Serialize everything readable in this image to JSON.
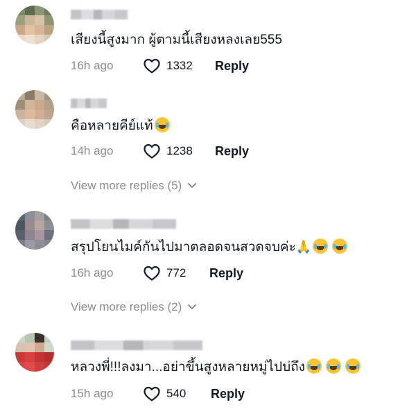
{
  "comments": [
    {
      "text": "เสียงนี้สูงมาก ผู้ตามนี้เสียงหลงเลย555",
      "emojis": [],
      "time": "16h ago",
      "likes": "1332",
      "reply_label": "Reply"
    },
    {
      "text": "คือหลายคีย์แท้",
      "emojis": [
        "😂"
      ],
      "time": "14h ago",
      "likes": "1238",
      "reply_label": "Reply",
      "view_more": "View more replies (5)"
    },
    {
      "text": "สรุปโยนไมค์กันไปมาตลอดจนสวดจบค่ะ",
      "emojis": [
        "🙏",
        "😂",
        "😂"
      ],
      "time": "16h ago",
      "likes": "772",
      "reply_label": "Reply",
      "view_more": "View more replies (2)"
    },
    {
      "text": "หลวงพี่!!!ลงมา...อย่าขึ้นสูงหลายหมู่ไปบ่ถึง",
      "emojis": [
        "😂",
        "😂",
        "😂"
      ],
      "time": "15h ago",
      "likes": "540",
      "reply_label": "Reply"
    }
  ],
  "colors": {
    "text": "#161823",
    "muted": "#8a8b91",
    "emoji": "#f7c438"
  },
  "icons": {
    "like": "heart-outline-icon",
    "expand": "chevron-down-icon",
    "laugh": "tears-of-joy-emoji",
    "pray": "folded-hands-emoji"
  }
}
